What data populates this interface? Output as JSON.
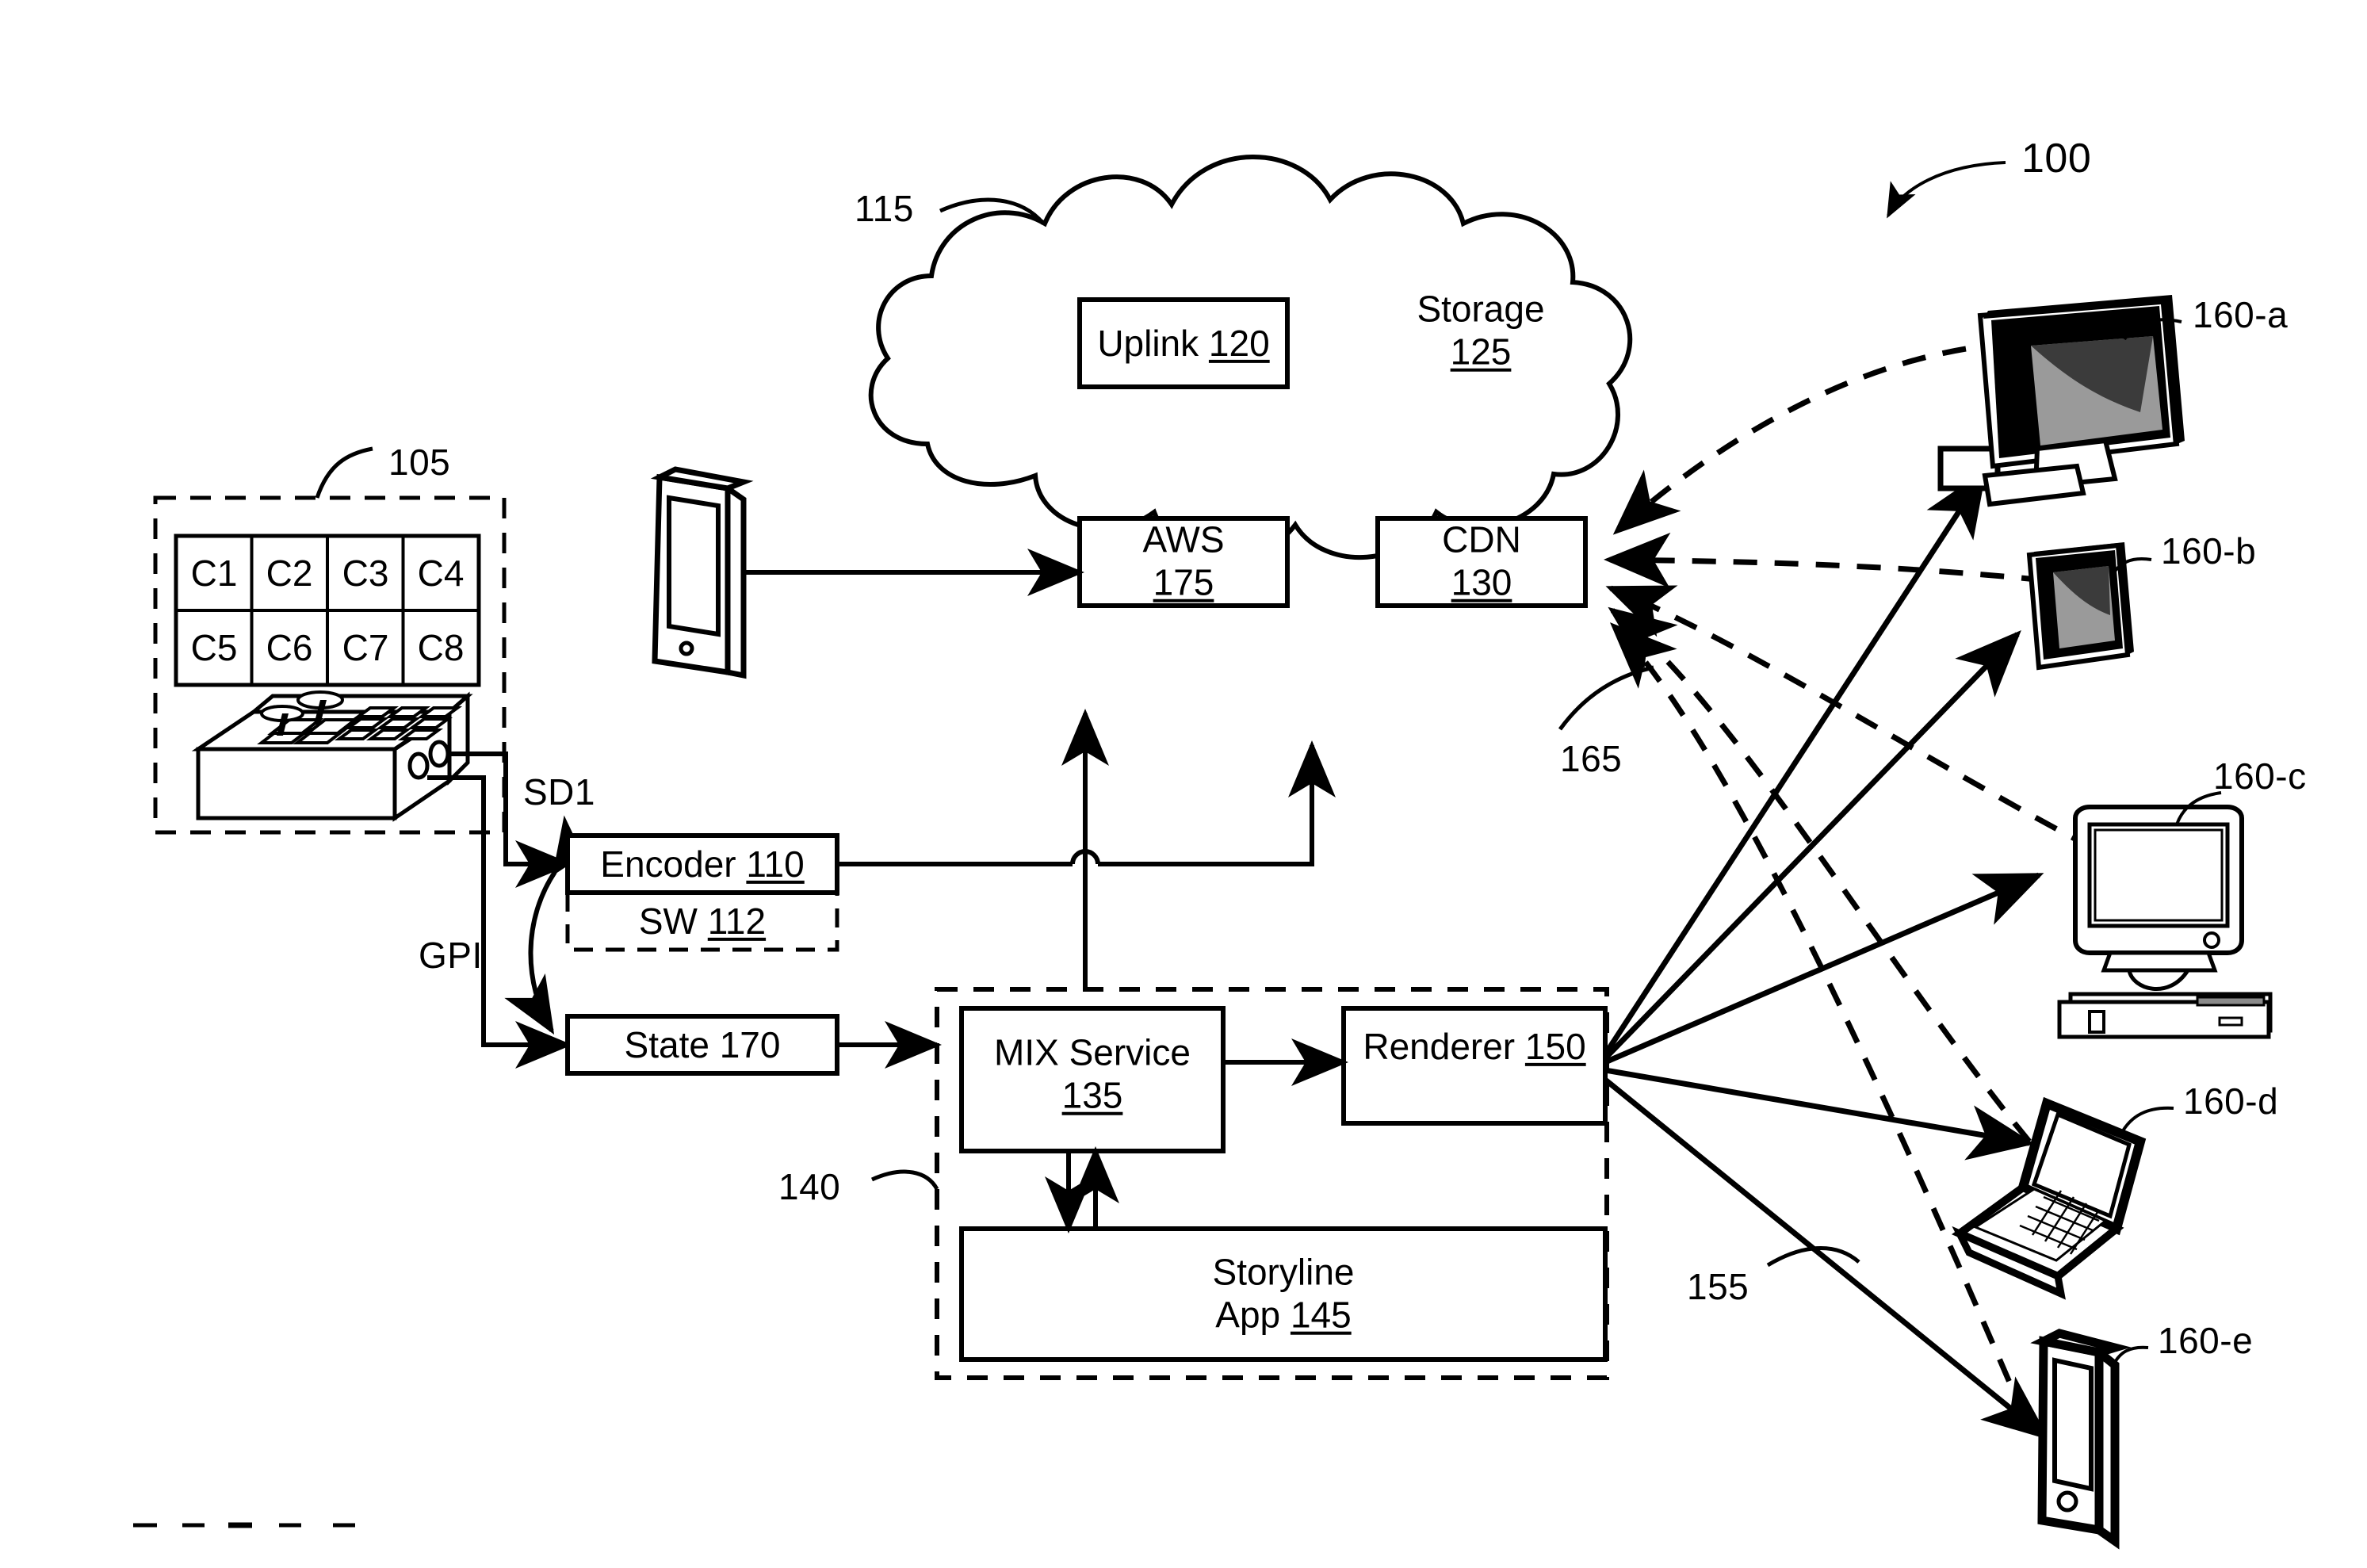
{
  "figure": {
    "system_ref": "100",
    "domain": "patent-system-architecture-diagram"
  },
  "capture_group": {
    "ref": "105",
    "camera_cells": [
      "C1",
      "C2",
      "C3",
      "C4",
      "C5",
      "C6",
      "C7",
      "C8"
    ],
    "console_name": "production-switcher-console"
  },
  "signals": {
    "sd1": "SD1",
    "gpi": "GPI"
  },
  "encoder": {
    "label": "Encoder",
    "ref": "110",
    "sub_label": "SW",
    "sub_ref": "112"
  },
  "state": {
    "label": "State 170"
  },
  "cloud": {
    "ref": "115",
    "nodes": [
      {
        "name": "uplink",
        "label": "Uplink",
        "ref": "120",
        "boxed": true,
        "inline": true
      },
      {
        "name": "storage",
        "label": "Storage",
        "ref": "125",
        "boxed": false,
        "inline": false
      },
      {
        "name": "aws",
        "label": "AWS",
        "ref": "175",
        "boxed": true,
        "inline": false
      },
      {
        "name": "cdn",
        "label": "CDN",
        "ref": "130",
        "boxed": true,
        "inline": false
      }
    ]
  },
  "mobile_client": {
    "name": "tablet-device"
  },
  "mix_group": {
    "ref": "140",
    "mix_service": {
      "label": "MIX Service",
      "ref": "135"
    },
    "renderer": {
      "label": "Renderer",
      "ref": "150"
    },
    "storyline": {
      "label_line1": "Storyline",
      "label_line2": "App",
      "ref": "145"
    }
  },
  "delivery": {
    "solid_path_ref": "155",
    "dashed_path_ref": "165"
  },
  "client_devices": [
    {
      "ref": "160-a",
      "kind": "desktop-monitor"
    },
    {
      "ref": "160-b",
      "kind": "tablet"
    },
    {
      "ref": "160-c",
      "kind": "crt-computer"
    },
    {
      "ref": "160-d",
      "kind": "laptop"
    },
    {
      "ref": "160-e",
      "kind": "smartphone"
    }
  ],
  "set_top_box": {
    "name": "set-top-box"
  }
}
